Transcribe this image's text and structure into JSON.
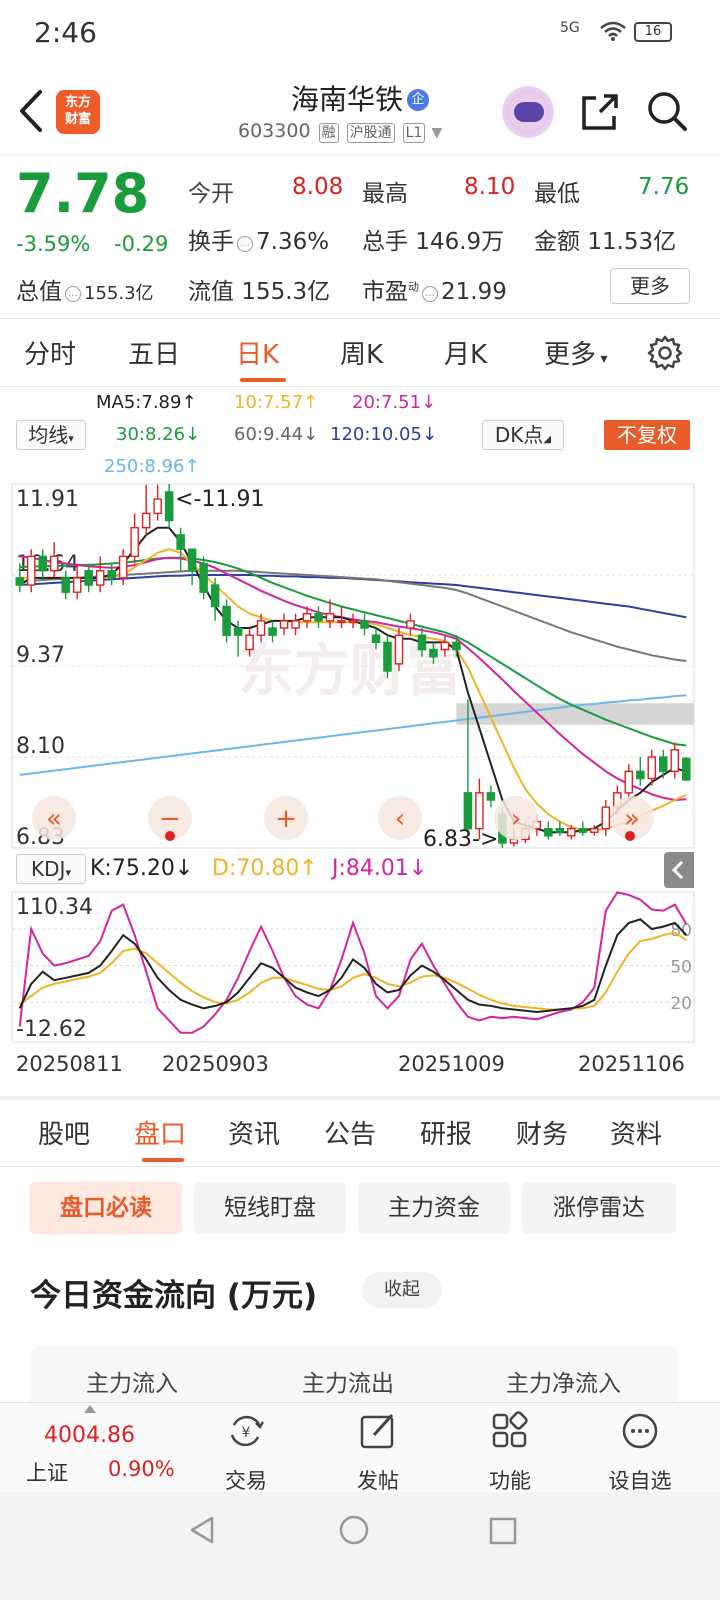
{
  "status": {
    "time": "2:46",
    "network": "5G",
    "battery": "16"
  },
  "header": {
    "logo_text": "东方\n财富",
    "stock_name": "海南华铁",
    "badge": "企",
    "code": "603300",
    "tags": [
      "融",
      "沪股通",
      "L1"
    ]
  },
  "quote": {
    "price": "7.78",
    "change_pct": "-3.59%",
    "change": "-0.29",
    "open_label": "今开",
    "open": "8.08",
    "high_label": "最高",
    "high": "8.10",
    "low_label": "最低",
    "low": "7.76",
    "turnover_label": "换手",
    "turnover": "7.36%",
    "volume_label": "总手",
    "volume": "146.9万",
    "amount_label": "金额",
    "amount": "11.53亿",
    "mktcap_label": "总值",
    "mktcap": "155.3亿",
    "float_label": "流值",
    "float": "155.3亿",
    "pe_label": "市盈",
    "pe_sup": "动",
    "pe": "21.99",
    "more": "更多"
  },
  "ktabs": [
    "分时",
    "五日",
    "日K",
    "周K",
    "月K",
    "更多"
  ],
  "ma": {
    "ma5": "MA5:7.89↑",
    "ma10": "10:7.57↑",
    "ma20": "20:7.51↓",
    "ma30": "30:8.26↓",
    "ma60": "60:9.44↓",
    "ma120": "120:10.05↓",
    "ma250": "250:8.96↑",
    "selector": "均线",
    "dk": "DK点",
    "fuquan": "不复权"
  },
  "colors": {
    "up": "#e02020",
    "down": "#1a9c3c",
    "accent": "#e85c2a",
    "ma5": "#222222",
    "ma10": "#f0b429",
    "ma20": "#d6249f",
    "ma30": "#1a9c3c",
    "ma60": "#777777",
    "ma120": "#2c3ea8",
    "ma250": "#6cb8e6"
  },
  "chart_data": {
    "type": "candlestick",
    "y_ticks": [
      "11.91",
      "10.64",
      "9.37",
      "8.10",
      "6.83"
    ],
    "max_label": "<-11.91",
    "min_label": "6.83->",
    "ylim": [
      6.83,
      11.91
    ],
    "watermark": "东方财富",
    "x_ticks": [
      "20250811",
      "20250903",
      "20251009",
      "20251106"
    ],
    "candles": [
      [
        10.6,
        10.5,
        10.8,
        10.4
      ],
      [
        10.5,
        10.9,
        11.0,
        10.4
      ],
      [
        10.9,
        10.7,
        11.0,
        10.6
      ],
      [
        10.7,
        10.9,
        11.1,
        10.6
      ],
      [
        10.6,
        10.4,
        10.7,
        10.3
      ],
      [
        10.4,
        10.6,
        10.8,
        10.3
      ],
      [
        10.7,
        10.5,
        10.8,
        10.4
      ],
      [
        10.5,
        10.7,
        10.9,
        10.4
      ],
      [
        10.7,
        10.6,
        10.8,
        10.5
      ],
      [
        10.6,
        10.9,
        11.0,
        10.5
      ],
      [
        10.9,
        11.3,
        11.5,
        10.8
      ],
      [
        11.3,
        11.5,
        11.9,
        11.2
      ],
      [
        11.5,
        11.7,
        11.9,
        11.4
      ],
      [
        11.8,
        11.4,
        11.91,
        11.3
      ],
      [
        11.2,
        11.0,
        11.3,
        10.7
      ],
      [
        11.0,
        10.7,
        11.0,
        10.5
      ],
      [
        10.8,
        10.4,
        10.9,
        10.3
      ],
      [
        10.5,
        10.2,
        10.6,
        10.0
      ],
      [
        10.2,
        9.8,
        10.3,
        9.7
      ],
      [
        9.9,
        9.8,
        10.0,
        9.5
      ],
      [
        9.6,
        9.8,
        9.9,
        9.5
      ],
      [
        9.8,
        10.0,
        10.1,
        9.7
      ],
      [
        9.9,
        9.8,
        10.0,
        9.7
      ],
      [
        9.9,
        10.0,
        10.1,
        9.8
      ],
      [
        9.9,
        10.0,
        10.1,
        9.8
      ],
      [
        10.0,
        10.1,
        10.2,
        9.9
      ],
      [
        10.1,
        10.0,
        10.2,
        9.9
      ],
      [
        10.0,
        10.1,
        10.3,
        9.9
      ],
      [
        10.0,
        10.0,
        10.2,
        9.9
      ],
      [
        10.0,
        10.0,
        10.1,
        9.9
      ],
      [
        10.0,
        9.9,
        10.1,
        9.8
      ],
      [
        9.8,
        9.7,
        9.9,
        9.6
      ],
      [
        9.7,
        9.3,
        9.8,
        9.2
      ],
      [
        9.4,
        9.8,
        9.9,
        9.3
      ],
      [
        9.9,
        10.0,
        10.1,
        9.8
      ],
      [
        9.8,
        9.6,
        9.9,
        9.5
      ],
      [
        9.6,
        9.5,
        9.7,
        9.4
      ],
      [
        9.6,
        9.7,
        9.8,
        9.5
      ],
      [
        9.7,
        9.6,
        9.8,
        9.5
      ],
      [
        7.6,
        7.1,
        8.9,
        7.0
      ],
      [
        7.1,
        7.6,
        7.8,
        6.95
      ],
      [
        7.6,
        7.5,
        7.7,
        7.4
      ],
      [
        7.3,
        6.9,
        7.4,
        6.83
      ],
      [
        6.9,
        6.95,
        7.1,
        6.85
      ],
      [
        6.95,
        7.1,
        7.2,
        6.9
      ],
      [
        7.1,
        7.2,
        7.3,
        7.0
      ],
      [
        7.1,
        7.0,
        7.2,
        6.95
      ],
      [
        7.1,
        7.05,
        7.2,
        7.0
      ],
      [
        7.0,
        7.1,
        7.15,
        6.95
      ],
      [
        7.1,
        7.05,
        7.2,
        7.0
      ],
      [
        7.05,
        7.1,
        7.15,
        7.0
      ],
      [
        7.1,
        7.4,
        7.5,
        7.0
      ],
      [
        7.4,
        7.6,
        7.7,
        7.3
      ],
      [
        7.6,
        7.9,
        8.0,
        7.5
      ],
      [
        7.9,
        7.8,
        8.1,
        7.7
      ],
      [
        7.8,
        8.1,
        8.2,
        7.7
      ],
      [
        8.1,
        7.9,
        8.2,
        7.8
      ],
      [
        7.9,
        8.2,
        8.3,
        7.8
      ],
      [
        8.08,
        7.78,
        8.1,
        7.76
      ]
    ],
    "ma_lines": {
      "ma5": [
        10.5,
        10.6,
        10.6,
        10.6,
        10.6,
        10.6,
        10.6,
        10.6,
        10.65,
        10.8,
        11.0,
        11.2,
        11.3,
        11.3,
        11.1,
        10.8,
        10.5,
        10.2,
        10.0,
        9.9,
        9.9,
        9.95,
        10.0,
        10.0,
        10.0,
        10.05,
        10.05,
        10.05,
        10.05,
        10.0,
        9.95,
        9.9,
        9.8,
        9.75,
        9.75,
        9.7,
        9.7,
        9.7,
        9.6,
        9.0,
        8.5,
        8.0,
        7.5,
        7.2,
        7.15,
        7.1,
        7.05,
        7.05,
        7.05,
        7.08,
        7.1,
        7.2,
        7.35,
        7.5,
        7.6,
        7.75,
        7.85,
        7.95,
        7.89
      ],
      "ma10": [
        10.6,
        10.6,
        10.6,
        10.6,
        10.6,
        10.6,
        10.6,
        10.6,
        10.6,
        10.65,
        10.75,
        10.85,
        10.95,
        11.0,
        10.95,
        10.8,
        10.65,
        10.5,
        10.35,
        10.2,
        10.1,
        10.05,
        10.0,
        10.0,
        9.98,
        9.98,
        9.98,
        9.98,
        9.98,
        9.98,
        9.97,
        9.95,
        9.9,
        9.85,
        9.8,
        9.78,
        9.75,
        9.72,
        9.6,
        9.35,
        9.0,
        8.65,
        8.3,
        7.95,
        7.65,
        7.45,
        7.3,
        7.2,
        7.12,
        7.08,
        7.07,
        7.1,
        7.15,
        7.2,
        7.28,
        7.35,
        7.42,
        7.5,
        7.57
      ],
      "ma20": [
        10.9,
        10.88,
        10.85,
        10.82,
        10.8,
        10.78,
        10.76,
        10.75,
        10.74,
        10.75,
        10.78,
        10.82,
        10.86,
        10.88,
        10.87,
        10.84,
        10.8,
        10.74,
        10.66,
        10.58,
        10.5,
        10.42,
        10.35,
        10.28,
        10.22,
        10.17,
        10.12,
        10.08,
        10.05,
        10.02,
        10.0,
        9.98,
        9.95,
        9.92,
        9.9,
        9.87,
        9.84,
        9.8,
        9.75,
        9.62,
        9.48,
        9.33,
        9.18,
        9.02,
        8.87,
        8.72,
        8.57,
        8.42,
        8.28,
        8.14,
        8.02,
        7.9,
        7.8,
        7.72,
        7.65,
        7.58,
        7.53,
        7.5,
        7.51
      ],
      "ma30": [
        10.75,
        10.76,
        10.76,
        10.77,
        10.77,
        10.78,
        10.78,
        10.79,
        10.8,
        10.81,
        10.83,
        10.85,
        10.87,
        10.88,
        10.88,
        10.87,
        10.85,
        10.82,
        10.78,
        10.73,
        10.67,
        10.6,
        10.53,
        10.47,
        10.41,
        10.35,
        10.3,
        10.25,
        10.2,
        10.16,
        10.12,
        10.08,
        10.04,
        10.0,
        9.96,
        9.92,
        9.88,
        9.84,
        9.78,
        9.7,
        9.6,
        9.5,
        9.4,
        9.3,
        9.2,
        9.1,
        9.0,
        8.91,
        8.83,
        8.76,
        8.69,
        8.62,
        8.56,
        8.5,
        8.44,
        8.38,
        8.33,
        8.28,
        8.26
      ],
      "ma60": [
        10.55,
        10.56,
        10.57,
        10.58,
        10.59,
        10.6,
        10.61,
        10.62,
        10.63,
        10.64,
        10.65,
        10.66,
        10.67,
        10.68,
        10.69,
        10.7,
        10.7,
        10.7,
        10.7,
        10.7,
        10.69,
        10.68,
        10.67,
        10.66,
        10.65,
        10.64,
        10.63,
        10.62,
        10.61,
        10.6,
        10.59,
        10.58,
        10.56,
        10.54,
        10.52,
        10.5,
        10.48,
        10.46,
        10.43,
        10.38,
        10.32,
        10.26,
        10.2,
        10.14,
        10.08,
        10.02,
        9.96,
        9.9,
        9.84,
        9.79,
        9.74,
        9.69,
        9.64,
        9.6,
        9.56,
        9.52,
        9.49,
        9.46,
        9.44
      ],
      "ma120": [
        10.5,
        10.51,
        10.52,
        10.53,
        10.54,
        10.55,
        10.56,
        10.57,
        10.58,
        10.59,
        10.6,
        10.61,
        10.62,
        10.63,
        10.63,
        10.64,
        10.64,
        10.64,
        10.64,
        10.64,
        10.64,
        10.63,
        10.63,
        10.62,
        10.62,
        10.61,
        10.61,
        10.6,
        10.6,
        10.59,
        10.58,
        10.57,
        10.56,
        10.55,
        10.54,
        10.53,
        10.52,
        10.51,
        10.5,
        10.48,
        10.46,
        10.44,
        10.42,
        10.4,
        10.38,
        10.36,
        10.34,
        10.32,
        10.3,
        10.28,
        10.26,
        10.24,
        10.22,
        10.2,
        10.17,
        10.14,
        10.11,
        10.08,
        10.05
      ],
      "ma250": [
        7.85,
        7.87,
        7.89,
        7.91,
        7.93,
        7.95,
        7.97,
        7.99,
        8.01,
        8.03,
        8.05,
        8.07,
        8.09,
        8.11,
        8.13,
        8.15,
        8.17,
        8.19,
        8.21,
        8.23,
        8.25,
        8.27,
        8.29,
        8.31,
        8.33,
        8.35,
        8.37,
        8.39,
        8.41,
        8.43,
        8.45,
        8.47,
        8.49,
        8.51,
        8.53,
        8.55,
        8.57,
        8.59,
        8.61,
        8.63,
        8.65,
        8.67,
        8.69,
        8.71,
        8.73,
        8.75,
        8.77,
        8.79,
        8.81,
        8.83,
        8.84,
        8.86,
        8.87,
        8.89,
        8.9,
        8.92,
        8.93,
        8.95,
        8.96
      ]
    },
    "kdj": {
      "selector": "KDJ",
      "k_label": "K:75.20↓",
      "d_label": "D:70.80↑",
      "j_label": "J:84.01↓",
      "y_max": "110.34",
      "y_min": "-12.62",
      "levels": [
        "80",
        "50",
        "20"
      ],
      "ylim": [
        -12.62,
        110.34
      ],
      "k": [
        15,
        35,
        45,
        38,
        40,
        42,
        44,
        50,
        62,
        75,
        68,
        55,
        40,
        30,
        22,
        18,
        15,
        17,
        20,
        28,
        40,
        52,
        48,
        40,
        32,
        28,
        25,
        30,
        40,
        55,
        48,
        35,
        28,
        30,
        42,
        50,
        45,
        38,
        30,
        22,
        18,
        17,
        15,
        14,
        13,
        12,
        13,
        14,
        15,
        17,
        22,
        50,
        75,
        85,
        88,
        80,
        82,
        85,
        75
      ],
      "d": [
        18,
        25,
        32,
        35,
        37,
        39,
        41,
        44,
        52,
        62,
        64,
        60,
        52,
        44,
        36,
        29,
        24,
        20,
        19,
        22,
        28,
        36,
        40,
        40,
        37,
        34,
        31,
        30,
        33,
        40,
        43,
        40,
        35,
        33,
        36,
        41,
        42,
        40,
        36,
        31,
        26,
        22,
        19,
        17,
        16,
        15,
        14,
        14,
        15,
        15,
        17,
        28,
        45,
        60,
        70,
        72,
        75,
        77,
        70.8
      ],
      "j": [
        0,
        80,
        60,
        50,
        52,
        55,
        58,
        70,
        95,
        100,
        75,
        45,
        15,
        5,
        -5,
        -5,
        0,
        10,
        22,
        40,
        62,
        82,
        62,
        40,
        25,
        18,
        15,
        30,
        55,
        85,
        60,
        25,
        15,
        25,
        55,
        68,
        50,
        35,
        20,
        8,
        5,
        8,
        7,
        8,
        7,
        6,
        9,
        12,
        14,
        20,
        32,
        95,
        110,
        108,
        104,
        96,
        95,
        100,
        84
      ]
    }
  },
  "chart_buttons": [
    "«",
    "−",
    "+",
    "‹",
    "›",
    "»"
  ],
  "tabs2": [
    "股吧",
    "盘口",
    "资讯",
    "公告",
    "研报",
    "财务",
    "资料"
  ],
  "chips": [
    "盘口必读",
    "短线盯盘",
    "主力资金",
    "涨停雷达"
  ],
  "flow": {
    "title": "今日资金流向 (万元)",
    "collapse": "收起",
    "headers": [
      "主力流入",
      "主力流出",
      "主力净流入"
    ]
  },
  "bottom": {
    "index_value": "4004.86",
    "index_name": "上证",
    "index_pct": "0.90%",
    "items": [
      {
        "label": "交易",
        "icon": "trade-icon"
      },
      {
        "label": "发帖",
        "icon": "post-icon"
      },
      {
        "label": "功能",
        "icon": "apps-icon"
      },
      {
        "label": "设自选",
        "icon": "more-circle-icon"
      }
    ]
  }
}
